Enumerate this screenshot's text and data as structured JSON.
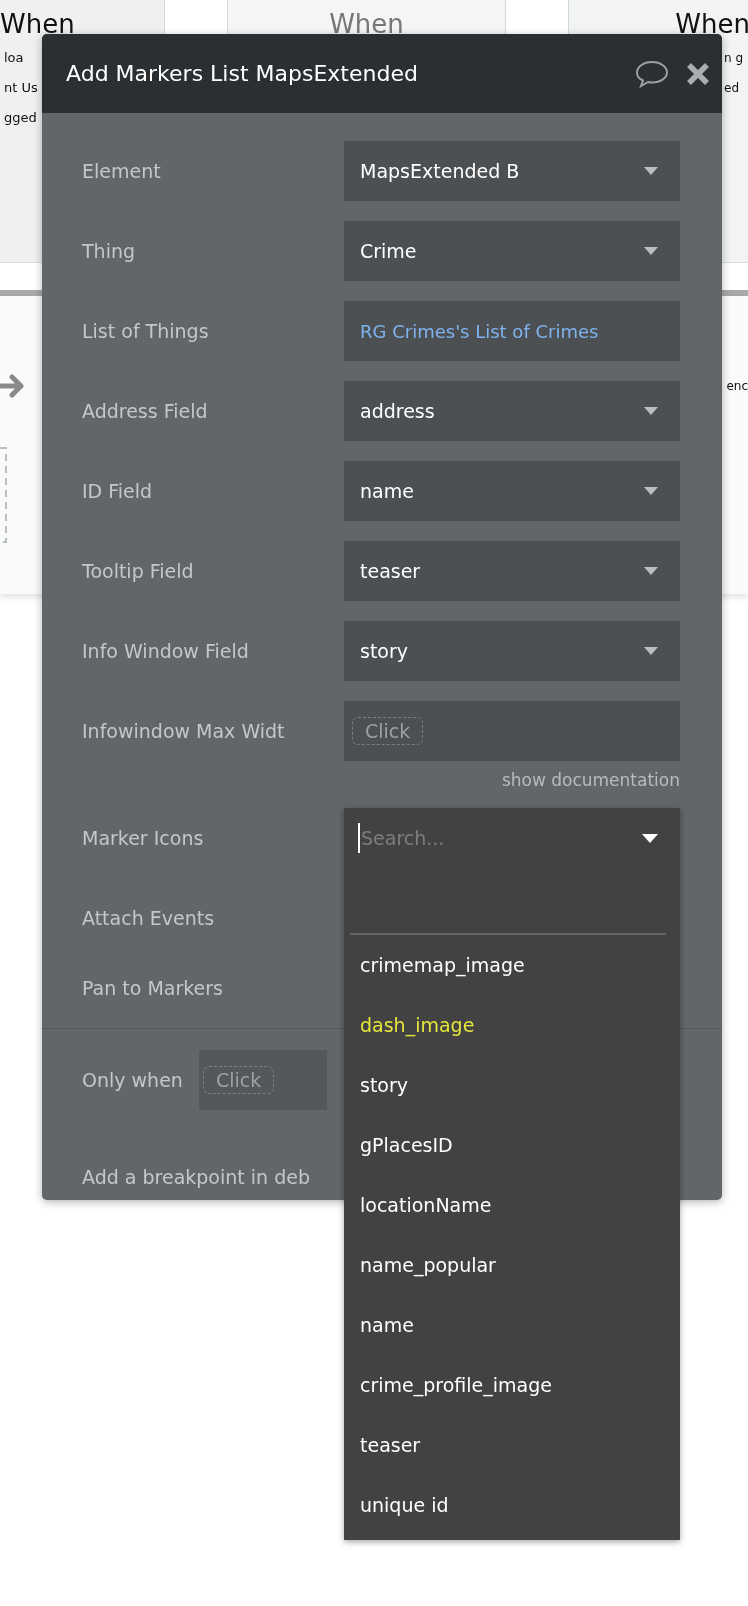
{
  "background": {
    "column_headers": [
      {
        "label": "When",
        "dimmed": false
      },
      {
        "label": "When",
        "dimmed": true
      },
      {
        "label": "When",
        "dimmed": false
      }
    ],
    "left_fragments": [
      "loa",
      "nt Us",
      "gged"
    ],
    "right_fragments": [
      "n g",
      "ed"
    ],
    "panel_fragment": "enc"
  },
  "dialog": {
    "title": "Add Markers List MapsExtended",
    "fields": [
      {
        "label": "Element",
        "kind": "dropdown",
        "value": "MapsExtended B"
      },
      {
        "label": "Thing",
        "kind": "dropdown",
        "value": "Crime"
      },
      {
        "label": "List of Things",
        "kind": "expression",
        "value": "RG Crimes's List of Crimes"
      },
      {
        "label": "Address Field",
        "kind": "dropdown",
        "value": "address"
      },
      {
        "label": "ID Field",
        "kind": "dropdown",
        "value": "name"
      },
      {
        "label": "Tooltip Field",
        "kind": "dropdown",
        "value": "teaser"
      },
      {
        "label": "Info Window Field",
        "kind": "dropdown",
        "value": "story"
      },
      {
        "label": "Infowindow Max Widt",
        "kind": "empty",
        "placeholder": "Click"
      }
    ],
    "doc_link": "show documentation",
    "extra_labels": [
      "Marker Icons",
      "Attach Events",
      "Pan to Markers"
    ],
    "condition": {
      "label": "Only when",
      "placeholder": "Click"
    },
    "breakpoint_label": "Add a breakpoint in deb"
  },
  "marker_dropdown": {
    "placeholder": "Search...",
    "options": [
      {
        "label": "crimemap_image",
        "selected": false
      },
      {
        "label": "dash_image",
        "selected": true
      },
      {
        "label": "story",
        "selected": false
      },
      {
        "label": "gPlacesID",
        "selected": false
      },
      {
        "label": "locationName",
        "selected": false
      },
      {
        "label": "name_popular",
        "selected": false
      },
      {
        "label": "name",
        "selected": false
      },
      {
        "label": "crime_profile_image",
        "selected": false
      },
      {
        "label": "teaser",
        "selected": false
      },
      {
        "label": "unique id",
        "selected": false
      }
    ]
  }
}
